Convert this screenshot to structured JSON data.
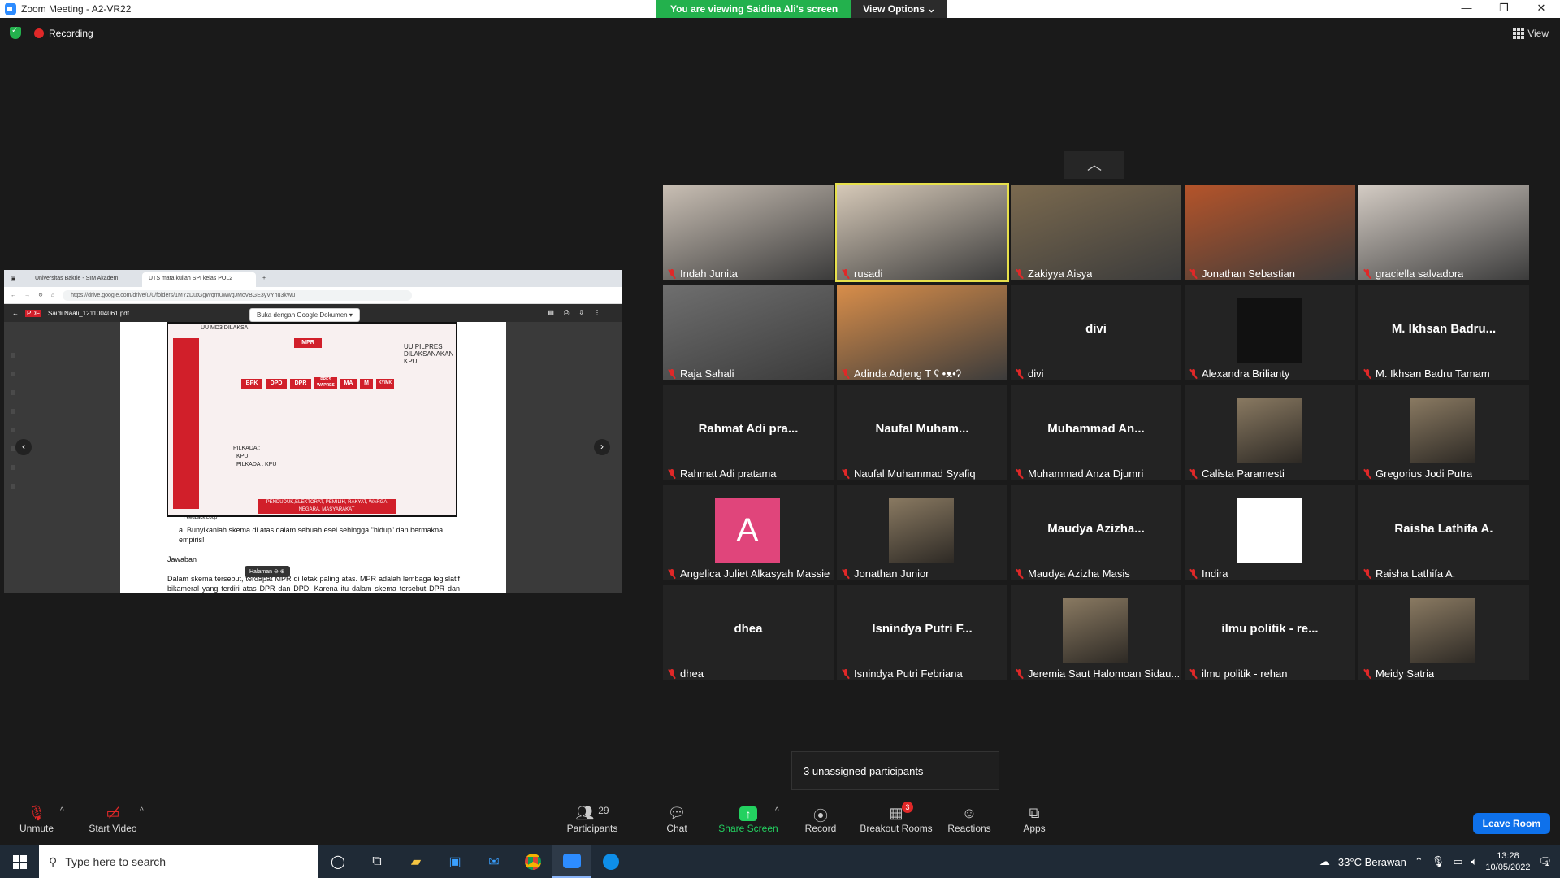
{
  "window": {
    "title": "Zoom Meeting - A2-VR22",
    "viewing_banner": "You are viewing Saidina Ali's screen",
    "view_options": "View Options",
    "controls": [
      "—",
      "❐",
      "✕"
    ]
  },
  "status": {
    "recording": "Recording",
    "view": "View"
  },
  "shared_screen": {
    "tabs": [
      "Universitas Bakrie - SIM Akadem",
      "UTS mata kuliah SPI kelas POL2"
    ],
    "url": "https://drive.google.com/drive/u/0/folders/1MYzDutGgWqmUwwgJMcVBGE3yVYhu3kWu",
    "file_name": "Saidi Naali_1211004061.pdf",
    "open_with": "Buka dengan Google Dokumen",
    "diagram": {
      "top_left_label": "UU MD3 DILAKSA",
      "mpr": "MPR",
      "boxes": [
        "BPK",
        "DPD",
        "DPR",
        "PRES WAPRES",
        "MA",
        "M",
        "KY/MK"
      ],
      "right_title": "UU PILPRES DILAKSANAKAN KPU",
      "pilkada1": "PILKADA :",
      "pilkada2": "KPU",
      "pilkada3": "PILKADA : KPU",
      "bottom": "PENDUDUK,ELEKTORAT, PEMILIH, RAKYAT, WARGA NEGARA, MASYARAKAT",
      "feedback": "Feedback Loop"
    },
    "question": "a.   Bunyikanlah skema di atas dalam sebuah esei sehingga \"hidup\" dan bermakna empiris!",
    "answer_label": "Jawaban",
    "answer_text": "Dalam skema tersebut, terdapat MPR di letak paling atas. MPR adalah lembaga legislatif bikameral yang terdiri atas DPR dan DPD. Karena itu dalam skema tersebut DPR dan DPD mempunyai tanda panah garis putus-putus yang mengarah ke",
    "page_label": "Halaman"
  },
  "participants": [
    {
      "name": "Indah Junita",
      "display": "",
      "speaking": false
    },
    {
      "name": "rusadi",
      "display": "",
      "speaking": true
    },
    {
      "name": "Zakiyya Aisya",
      "display": "",
      "speaking": false
    },
    {
      "name": "Jonathan Sebastian",
      "display": "",
      "speaking": false
    },
    {
      "name": "graciella salvadora",
      "display": "",
      "speaking": false
    },
    {
      "name": "Raja Sahali",
      "display": "",
      "speaking": false
    },
    {
      "name": "Adinda Adjeng T ʕ •ᴥ•ʔ",
      "display": "",
      "speaking": false
    },
    {
      "name": "divi",
      "display": "divi",
      "speaking": false
    },
    {
      "name": "Alexandra Brilianty",
      "display": "",
      "speaking": false
    },
    {
      "name": "M. Ikhsan Badru Tamam",
      "display": "M. Ikhsan Badru...",
      "speaking": false
    },
    {
      "name": "Rahmat Adi pratama",
      "display": "Rahmat Adi pra...",
      "speaking": false
    },
    {
      "name": "Naufal Muhammad Syafiq",
      "display": "Naufal Muham...",
      "speaking": false
    },
    {
      "name": "Muhammad Anza Djumri",
      "display": "Muhammad An...",
      "speaking": false
    },
    {
      "name": "Calista Paramesti",
      "display": "",
      "speaking": false
    },
    {
      "name": "Gregorius Jodi Putra",
      "display": "",
      "speaking": false
    },
    {
      "name": "Angelica Juliet Alkasyah Massie",
      "display": "",
      "speaking": false,
      "avatar_letter": "A"
    },
    {
      "name": "Jonathan Junior",
      "display": "",
      "speaking": false
    },
    {
      "name": "Maudya Azizha Masis",
      "display": "Maudya  Azizha...",
      "speaking": false
    },
    {
      "name": "Indira",
      "display": "",
      "speaking": false
    },
    {
      "name": "Raisha Lathifa A.",
      "display": "Raisha Lathifa A.",
      "speaking": false
    },
    {
      "name": "dhea",
      "display": "dhea",
      "speaking": false
    },
    {
      "name": "Isnindya Putri Febriana",
      "display": "Isnindya Putri F...",
      "speaking": false
    },
    {
      "name": "Jeremia Saut Halomoan Sidau...",
      "display": "",
      "speaking": false
    },
    {
      "name": "ilmu politik - rehan",
      "display": "ilmu politik - re...",
      "speaking": false
    },
    {
      "name": "Meidy Satria",
      "display": "",
      "speaking": false
    }
  ],
  "unassigned": "3 unassigned participants",
  "toolbar": {
    "unmute": "Unmute",
    "start_video": "Start Video",
    "participants": "Participants",
    "participants_count": "29",
    "chat": "Chat",
    "share_screen": "Share Screen",
    "record": "Record",
    "breakout_rooms": "Breakout Rooms",
    "breakout_badge": "3",
    "reactions": "Reactions",
    "apps": "Apps",
    "leave": "Leave Room"
  },
  "taskbar": {
    "search_placeholder": "Type here to search",
    "weather": "33°C  Berawan",
    "time": "13:28",
    "date": "10/05/2022",
    "notifications": "1"
  }
}
